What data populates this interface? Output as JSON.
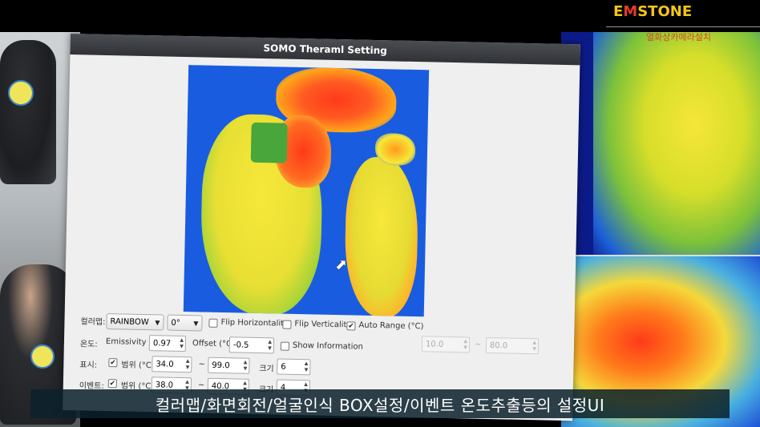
{
  "brand": {
    "prefix": "E",
    "accent": "M",
    "suffix": "STONE",
    "subtitle": "열화상카메라설치"
  },
  "dialog": {
    "title": "SOMO Theraml Setting"
  },
  "row_colormap": {
    "label": "컬러맵:",
    "colormap_value": "RAINBOW",
    "rotation_value": "0°",
    "flip_h_label": "Flip Horizontality",
    "flip_h_checked": false,
    "flip_v_label": "Flip Verticality",
    "flip_v_checked": false,
    "auto_range_label": "Auto Range (°C)",
    "auto_range_checked": true
  },
  "row_temp": {
    "label": "온도:",
    "emissivity_label": "Emissivity (ε)",
    "emissivity_value": "0.97",
    "offset_label": "Offset (°C)",
    "offset_value": "-0.5",
    "show_info_label": "Show Information",
    "show_info_checked": false,
    "range_min": "10.0",
    "range_sep": "~",
    "range_max": "80.0"
  },
  "row_display": {
    "label": "표시:",
    "checked": true,
    "range_label": "범위 (°C)",
    "min": "34.0",
    "sep": "~",
    "max": "99.0",
    "size_label": "크기",
    "size_value": "6"
  },
  "row_event": {
    "label": "이벤트:",
    "checked": true,
    "range_label": "범위 (°C)",
    "min": "38.0",
    "sep": "~",
    "max": "40.0",
    "size_label": "크기",
    "size_value": "4"
  },
  "caption": "컬러맵/화면회전/얼굴인식 BOX설정/이벤트 온도추출등의 설정UI",
  "colors": {
    "brand_yellow": "#f5c518",
    "brand_red": "#e23b2b",
    "thermal_blue": "#1a5ce0",
    "thermal_yellow": "#f3e23a",
    "thermal_red": "#ff3a1a"
  }
}
